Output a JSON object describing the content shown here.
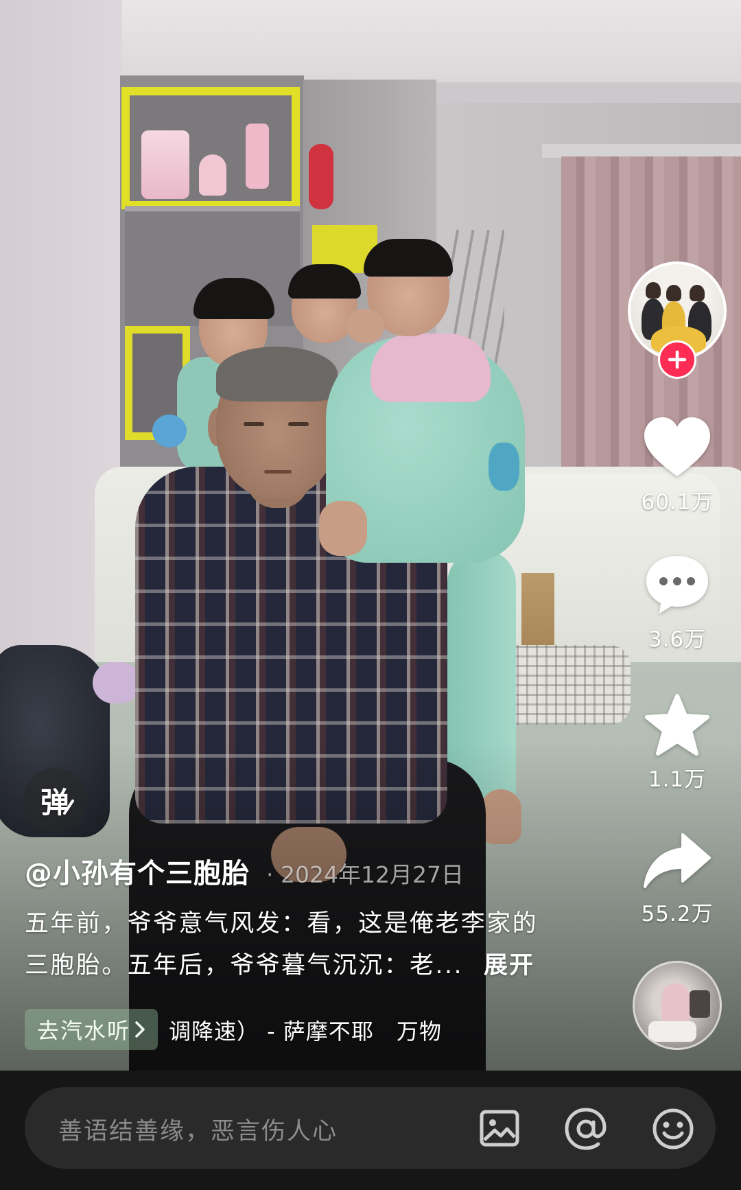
{
  "video": {
    "danmu_label": "弹"
  },
  "author": {
    "handle": "@小孙有个三胞胎",
    "date": "· 2024年12月27日"
  },
  "description": {
    "lines": [
      "五年前，爷爷意气风发：看，这是俺老李家的",
      "三胞胎。五年后，爷爷暮气沉沉：老..."
    ],
    "expand_label": "展开"
  },
  "music": {
    "chip_label": "去汽水听",
    "chip_icon": "chevron-right-icon",
    "track": "调降速） - 萨摩不耶　万物"
  },
  "actions": {
    "follow_icon": "plus-icon",
    "like": {
      "icon": "heart-icon",
      "count": "60.1万"
    },
    "comment": {
      "icon": "comment-bubble-icon",
      "count": "3.6万"
    },
    "favorite": {
      "icon": "star-icon",
      "count": "1.1万"
    },
    "share": {
      "icon": "share-arrow-icon",
      "count": "55.2万"
    }
  },
  "comment_bar": {
    "placeholder": "善语结善缘，恶言伤人心",
    "icons": [
      "image-icon",
      "at-mention-icon",
      "emoji-icon"
    ]
  },
  "colors": {
    "follow_badge": "#fe2c55",
    "comment_bar_bg": "#161616",
    "input_bg": "#2a2a2a",
    "placeholder": "#8b8b8b",
    "text": "#ffffff"
  }
}
